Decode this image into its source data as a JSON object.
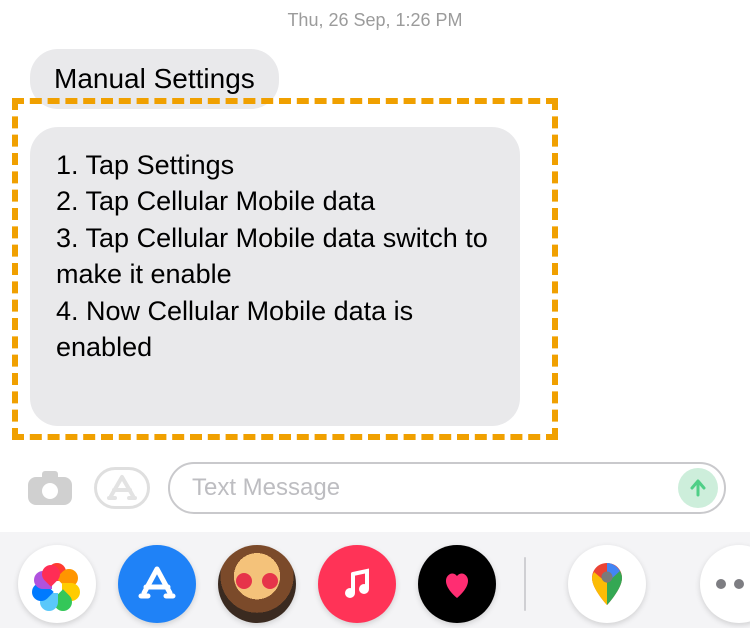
{
  "timestamp": "Thu, 26 Sep, 1:26 PM",
  "messages": {
    "title": "Manual Settings",
    "steps_text": "1. Tap Settings\n2. Tap Cellular Mobile data\n3. Tap Cellular Mobile data switch to make it enable\n4. Now Cellular Mobile data is enabled"
  },
  "compose": {
    "placeholder": "Text Message"
  },
  "dock": {
    "apps": [
      "Photos",
      "App Store",
      "Memoji",
      "Music",
      "Health",
      "Google Maps",
      "More"
    ]
  }
}
